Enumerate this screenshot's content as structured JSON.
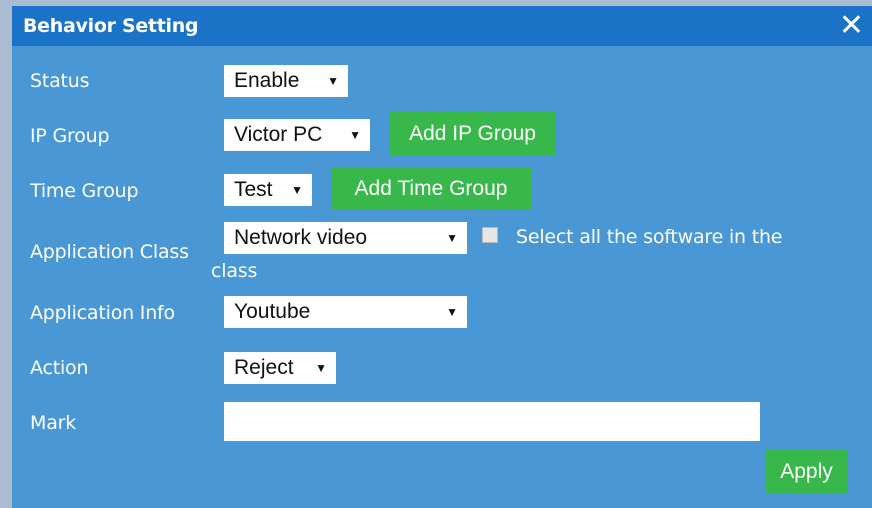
{
  "dialog": {
    "title": "Behavior Setting",
    "close_icon": "✕"
  },
  "form": {
    "status": {
      "label": "Status",
      "value": "Enable"
    },
    "ip_group": {
      "label": "IP Group",
      "value": "Victor PC",
      "button": "Add IP Group"
    },
    "time_group": {
      "label": "Time Group",
      "value": "Test",
      "button": "Add Time Group"
    },
    "application_class": {
      "label": "Application Class",
      "value": "Network video",
      "select_all_label_line1": "Select all the software in the",
      "select_all_label_line2": "class",
      "select_all_checked": false
    },
    "application_info": {
      "label": "Application Info",
      "value": "Youtube"
    },
    "action": {
      "label": "Action",
      "value": "Reject"
    },
    "mark": {
      "label": "Mark",
      "value": ""
    },
    "apply_button": "Apply"
  },
  "icons": {
    "dropdown": "▼"
  },
  "colors": {
    "header": "#1a73c7",
    "body": "#4a97d6",
    "button": "#38b84a",
    "backdrop": "#a9bcd1"
  }
}
